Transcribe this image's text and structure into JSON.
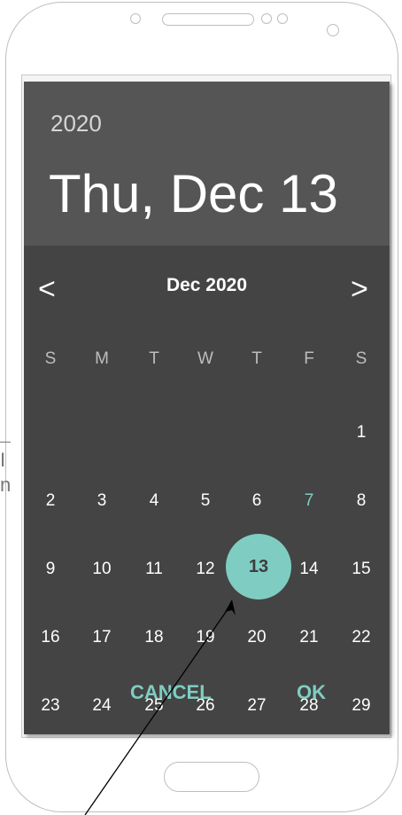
{
  "header": {
    "year": "2020",
    "selected_date": "Thu, Dec 13"
  },
  "calendar": {
    "month_label": "Dec 2020",
    "prev_label": "<",
    "next_label": ">",
    "weekdays": [
      "S",
      "M",
      "T",
      "W",
      "T",
      "F",
      "S"
    ],
    "weeks": [
      [
        "",
        "",
        "",
        "",
        "",
        "",
        "1"
      ],
      [
        "2",
        "3",
        "4",
        "5",
        "6",
        "7",
        "8"
      ],
      [
        "9",
        "10",
        "11",
        "12",
        "13",
        "14",
        "15"
      ],
      [
        "16",
        "17",
        "18",
        "19",
        "20",
        "21",
        "22"
      ],
      [
        "23",
        "24",
        "25",
        "26",
        "27",
        "28",
        "29"
      ]
    ],
    "selected_day": "13",
    "highlighted_day": "7"
  },
  "actions": {
    "cancel_label": "CANCEL",
    "ok_label": "OK"
  },
  "colors": {
    "accent": "#7fcdc2",
    "dialog_bg": "#444444",
    "header_bg": "#555555"
  },
  "side": {
    "text_line1": "I",
    "text_line2": "n"
  }
}
